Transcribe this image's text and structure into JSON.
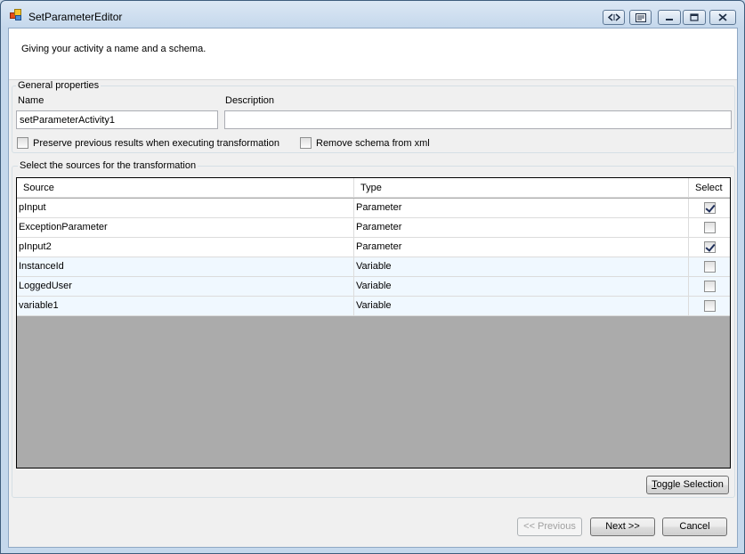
{
  "window": {
    "title": "SetParameterEditor"
  },
  "header": {
    "description": "Giving your activity a name and a schema."
  },
  "general": {
    "legend": "General properties",
    "name_label": "Name",
    "name_value": "setParameterActivity1",
    "description_label": "Description",
    "description_value": "",
    "preserve_label": "Preserve previous results when executing transformation",
    "preserve_checked": false,
    "remove_schema_label": "Remove schema from xml",
    "remove_schema_checked": false
  },
  "sources": {
    "legend": "Select the sources for the transformation",
    "columns": [
      "Source",
      "Type",
      "Select"
    ],
    "rows": [
      {
        "source": "pInput",
        "type": "Parameter",
        "selected": true
      },
      {
        "source": "ExceptionParameter",
        "type": "Parameter",
        "selected": false
      },
      {
        "source": "pInput2",
        "type": "Parameter",
        "selected": true
      },
      {
        "source": "InstanceId",
        "type": "Variable",
        "selected": false
      },
      {
        "source": "LoggedUser",
        "type": "Variable",
        "selected": false
      },
      {
        "source": "variable1",
        "type": "Variable",
        "selected": false
      }
    ],
    "toggle_prefix": "T",
    "toggle_rest": "oggle Selection"
  },
  "footer": {
    "previous_label": "<< Previous",
    "next_label": "Next >>",
    "cancel_label": "Cancel"
  }
}
